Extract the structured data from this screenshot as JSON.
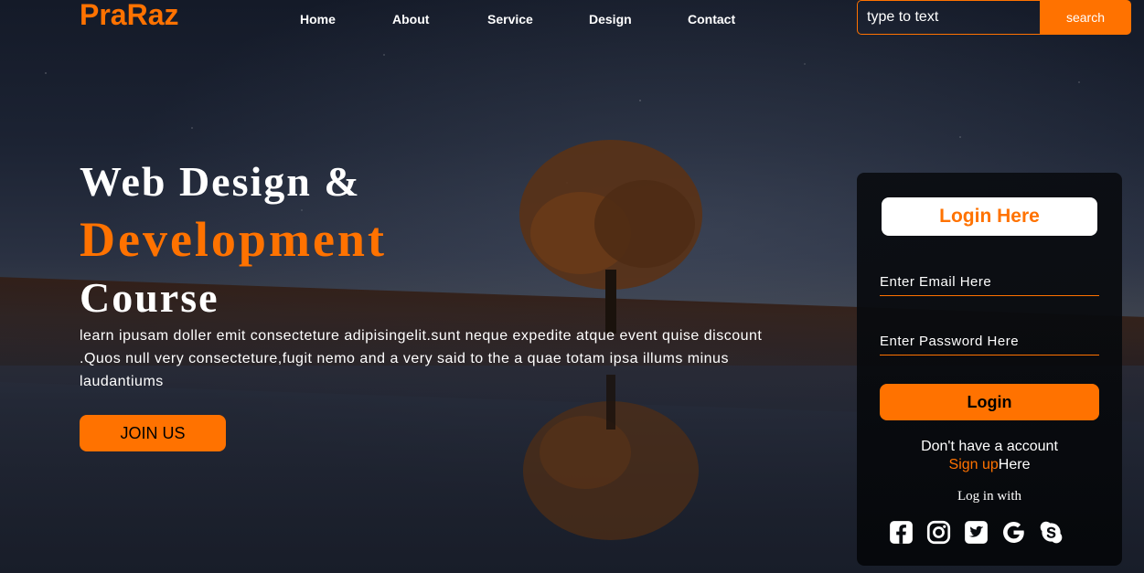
{
  "header": {
    "logo": "PraRaz",
    "nav": [
      "Home",
      "About",
      "Service",
      "Design",
      "Contact"
    ],
    "search_placeholder": "type to text",
    "search_button": "search"
  },
  "hero": {
    "title_line1": "Web Design &",
    "title_line2": "Development",
    "title_line3": "Course",
    "description": "learn ipusam doller emit consecteture adipisingelit.sunt neque expedite atque event quise discount .Quos null very consecteture,fugit nemo and a very said to the a quae totam ipsa illums minus laudantiums",
    "join_button": "JOIN US"
  },
  "login": {
    "heading": "Login Here",
    "email_placeholder": "Enter Email Here",
    "password_placeholder": "Enter Password Here",
    "button": "Login",
    "no_account": "Don't have a account",
    "signup_link": "Sign up",
    "signup_suffix": "Here",
    "social_title": "Log in with",
    "social_icons": [
      "facebook-icon",
      "instagram-icon",
      "twitter-icon",
      "google-icon",
      "skype-icon"
    ]
  },
  "colors": {
    "accent": "#ff7200"
  }
}
